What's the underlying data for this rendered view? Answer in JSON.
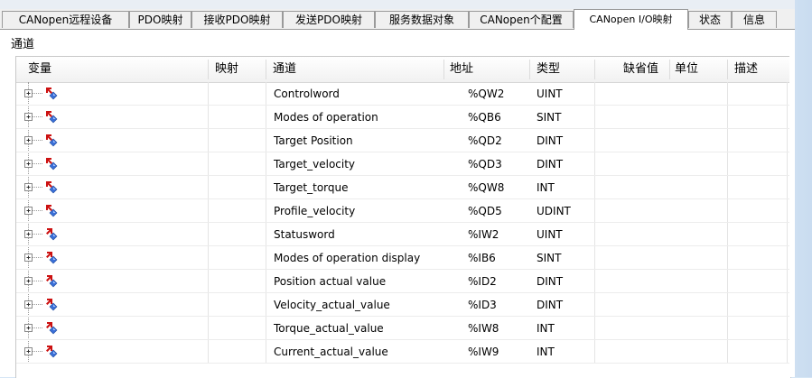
{
  "tabs": [
    {
      "label": "CANopen远程设备",
      "active": false
    },
    {
      "label": "PDO映射",
      "active": false
    },
    {
      "label": "接收PDO映射",
      "active": false
    },
    {
      "label": "发送PDO映射",
      "active": false
    },
    {
      "label": "服务数据对象",
      "active": false
    },
    {
      "label": "CANopen个配置",
      "active": false
    },
    {
      "label": "CANopen I/O映射",
      "active": true
    },
    {
      "label": "状态",
      "active": false
    },
    {
      "label": "信息",
      "active": false
    }
  ],
  "section_title": "通道",
  "columns": {
    "variable": "变量",
    "mapping": "映射",
    "channel": "通道",
    "address": "地址",
    "type": "类型",
    "default": "缺省值",
    "unit": "单位",
    "description": "描述"
  },
  "rows": [
    {
      "channel": "Controlword",
      "address": "%QW2",
      "type": "UINT",
      "direction": "output"
    },
    {
      "channel": "Modes of operation",
      "address": "%QB6",
      "type": "SINT",
      "direction": "output"
    },
    {
      "channel": "Target Position",
      "address": "%QD2",
      "type": "DINT",
      "direction": "output"
    },
    {
      "channel": "Target_velocity",
      "address": "%QD3",
      "type": "DINT",
      "direction": "output"
    },
    {
      "channel": "Target_torque",
      "address": "%QW8",
      "type": "INT",
      "direction": "output"
    },
    {
      "channel": "Profile_velocity",
      "address": "%QD5",
      "type": "UDINT",
      "direction": "output"
    },
    {
      "channel": "Statusword",
      "address": "%IW2",
      "type": "UINT",
      "direction": "input"
    },
    {
      "channel": "Modes of operation display",
      "address": "%IB6",
      "type": "SINT",
      "direction": "input"
    },
    {
      "channel": "Position actual value",
      "address": "%ID2",
      "type": "DINT",
      "direction": "input"
    },
    {
      "channel": "Velocity_actual_value",
      "address": "%ID3",
      "type": "DINT",
      "direction": "input"
    },
    {
      "channel": "Torque_actual_value",
      "address": "%IW8",
      "type": "INT",
      "direction": "input"
    },
    {
      "channel": "Current_actual_value",
      "address": "%IW9",
      "type": "INT",
      "direction": "input"
    }
  ],
  "icons": {
    "expander": "tree-expand-plus-icon",
    "output_var": "output-variable-icon",
    "input_var": "input-variable-icon"
  },
  "colors": {
    "arrow_red": "#cc1111",
    "var_blue": "#3a6fd8",
    "background_blue": "#d6e6f5"
  }
}
